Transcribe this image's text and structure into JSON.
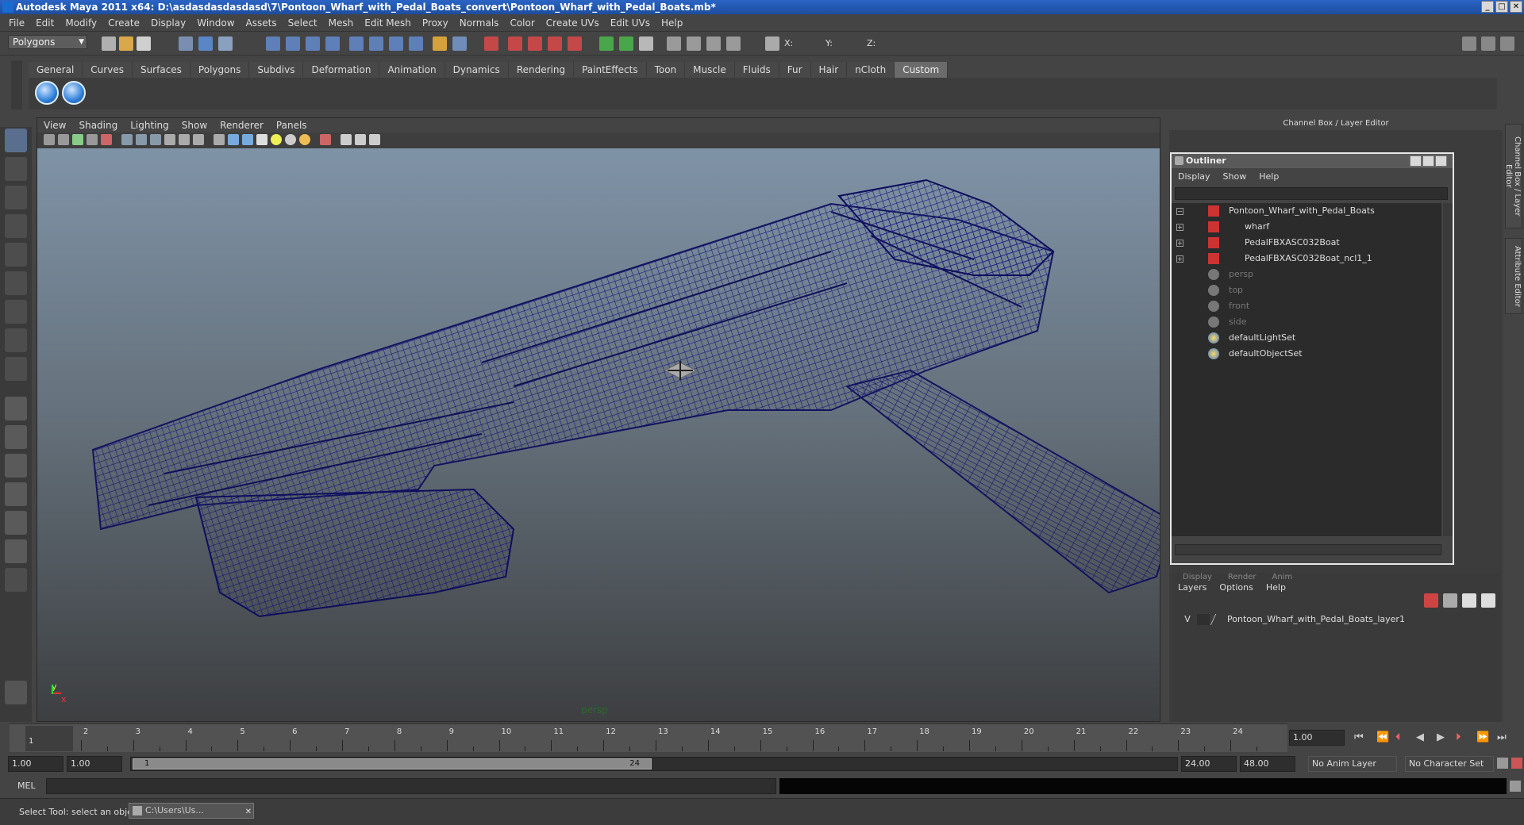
{
  "window": {
    "title": "Autodesk Maya 2011 x64: D:\\asdasdasdasdasd\\7\\Pontoon_Wharf_with_Pedal_Boats_convert\\Pontoon_Wharf_with_Pedal_Boats.mb*",
    "minimize": "_",
    "maximize": "□",
    "close": "✕"
  },
  "menubar": [
    "File",
    "Edit",
    "Modify",
    "Create",
    "Display",
    "Window",
    "Assets",
    "Select",
    "Mesh",
    "Edit Mesh",
    "Proxy",
    "Normals",
    "Color",
    "Create UVs",
    "Edit UVs",
    "Help"
  ],
  "statusline": {
    "mode": "Polygons",
    "x_label": "X:",
    "y_label": "Y:",
    "z_label": "Z:"
  },
  "shelf": {
    "tabs": [
      "General",
      "Curves",
      "Surfaces",
      "Polygons",
      "Subdivs",
      "Deformation",
      "Animation",
      "Dynamics",
      "Rendering",
      "PaintEffects",
      "Toon",
      "Muscle",
      "Fluids",
      "Fur",
      "Hair",
      "nCloth",
      "Custom"
    ],
    "active_tab": "Custom"
  },
  "viewport": {
    "menu": [
      "View",
      "Shading",
      "Lighting",
      "Show",
      "Renderer",
      "Panels"
    ],
    "camera_label": "persp",
    "axis_y": "y",
    "axis_x": "x",
    "wire_color": "#1a1a7a"
  },
  "channel_box": {
    "header": "Channel Box / Layer Editor",
    "tab_channel": "Channel Box / Layer Editor",
    "tab_attr": "Attribute Editor"
  },
  "outliner": {
    "title": "Outliner",
    "menu": [
      "Display",
      "Show",
      "Help"
    ],
    "items": [
      {
        "label": "Pontoon_Wharf_with_Pedal_Boats",
        "exp": "−"
      },
      {
        "label": "wharf",
        "exp": "+"
      },
      {
        "label": "PedalFBXASC032Boat",
        "exp": "+"
      },
      {
        "label": "PedalFBXASC032Boat_ncl1_1",
        "exp": "+"
      },
      {
        "label": "persp",
        "exp": ""
      },
      {
        "label": "top",
        "exp": ""
      },
      {
        "label": "front",
        "exp": ""
      },
      {
        "label": "side",
        "exp": ""
      },
      {
        "label": "defaultLightSet",
        "exp": ""
      },
      {
        "label": "defaultObjectSet",
        "exp": ""
      }
    ]
  },
  "layer_editor": {
    "tabs": [
      "Display",
      "Render",
      "Anim"
    ],
    "menu": [
      "Layers",
      "Options",
      "Help"
    ],
    "layer_visible": "V",
    "layer_name": "Pontoon_Wharf_with_Pedal_Boats_layer1"
  },
  "timeline": {
    "ticks": [
      "1",
      "2",
      "3",
      "4",
      "5",
      "6",
      "7",
      "8",
      "9",
      "10",
      "11",
      "12",
      "13",
      "14",
      "15",
      "16",
      "17",
      "18",
      "19",
      "20",
      "21",
      "22",
      "23",
      "24"
    ],
    "current_frame_marker": "1",
    "current_time": "1.00"
  },
  "range": {
    "start": "1.00",
    "playback_start": "1.00",
    "slider_start": "1",
    "slider_end": "24",
    "playback_end": "24.00",
    "end": "48.00",
    "anim_layer": "No Anim Layer",
    "char_set": "No Character Set"
  },
  "command": {
    "label": "MEL"
  },
  "help": {
    "text": "Select Tool: select an object",
    "task": "C:\\Users\\Us..."
  }
}
